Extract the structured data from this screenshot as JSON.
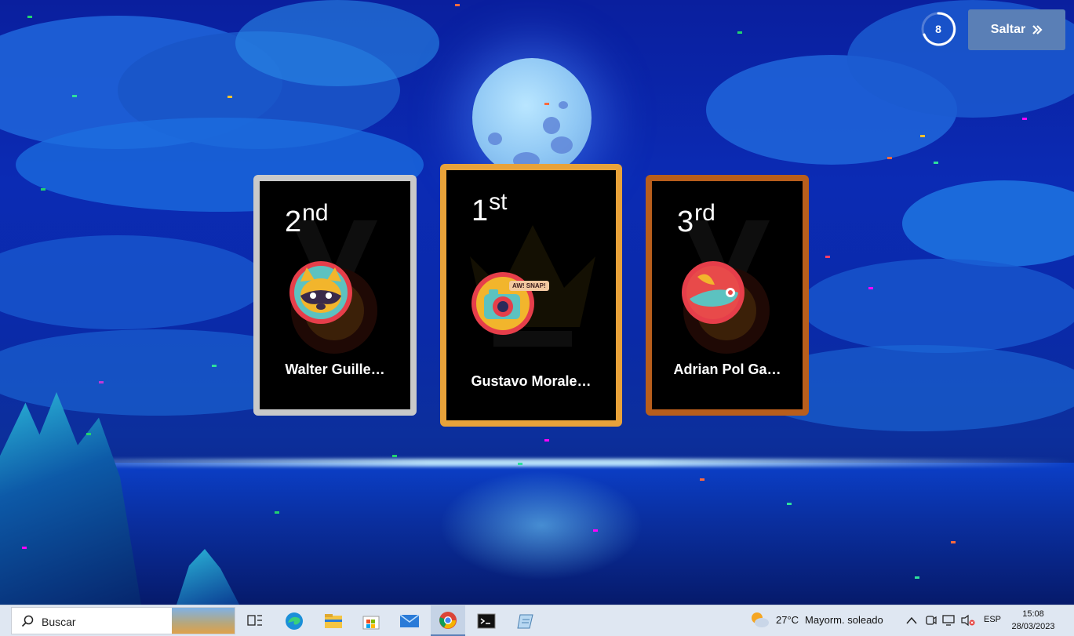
{
  "header": {
    "timer_value": "8",
    "skip_label": "Saltar",
    "skip_icon": "double-chevron-right-icon"
  },
  "podium": [
    {
      "place_number": "1",
      "place_suffix": "st",
      "name": "Gustavo Morale…",
      "avatar": "camera-awsnap-avatar",
      "avatar_badge": "AW! SNAP!",
      "frame_color": "#e8a23a"
    },
    {
      "place_number": "2",
      "place_suffix": "nd",
      "name": "Walter Guille…",
      "avatar": "raccoon-avatar",
      "frame_color": "#c9c9c9"
    },
    {
      "place_number": "3",
      "place_suffix": "rd",
      "name": "Adrian Pol Ga…",
      "avatar": "green-hat-avatar",
      "frame_color": "#b85e1c"
    }
  ],
  "taskbar": {
    "search_placeholder": "Buscar",
    "apps": [
      "task-view-icon",
      "edge-icon",
      "file-explorer-icon",
      "store-icon",
      "mail-icon",
      "chrome-icon",
      "terminal-icon",
      "notepad-icon"
    ],
    "weather_temp": "27°C",
    "weather_desc": "Mayorm. soleado",
    "language": "ESP",
    "time": "15:08",
    "date": "28/03/2023"
  }
}
